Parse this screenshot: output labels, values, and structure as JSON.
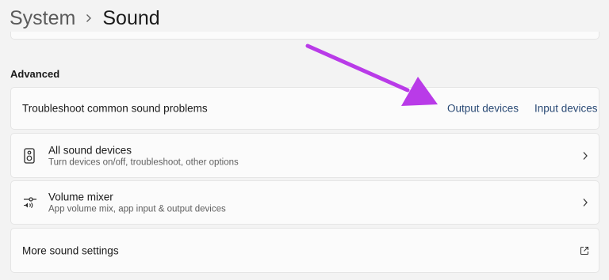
{
  "breadcrumb": {
    "parent": "System",
    "current": "Sound"
  },
  "advanced": {
    "section_title": "Advanced",
    "troubleshoot": {
      "label": "Troubleshoot common sound problems",
      "output_link": "Output devices",
      "input_link": "Input devices"
    },
    "all_devices": {
      "title": "All sound devices",
      "subtitle": "Turn devices on/off, troubleshoot, other options",
      "icon": "speaker-icon"
    },
    "volume_mixer": {
      "title": "Volume mixer",
      "subtitle": "App volume mix, app input & output devices",
      "icon": "volume-mixer-icon"
    },
    "more_settings": {
      "label": "More sound settings",
      "icon": "external-link-icon"
    }
  },
  "colors": {
    "annotation_arrow": "#b93be8",
    "link": "#2a4a75",
    "page_background": "#f3f3f3",
    "card_background": "#fbfbfb"
  }
}
